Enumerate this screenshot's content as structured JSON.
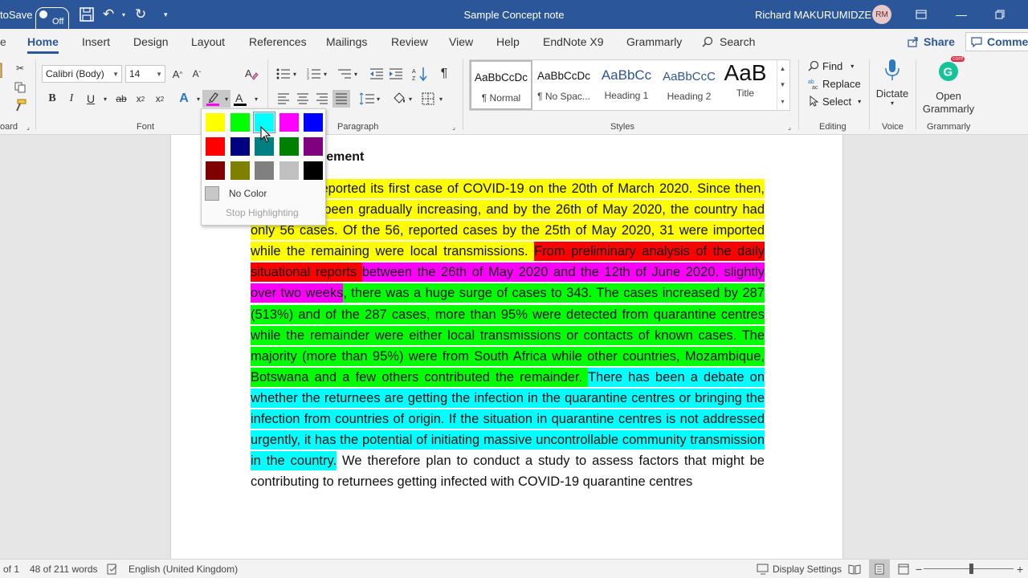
{
  "titlebar": {
    "autosave_label": "toSave",
    "toggle_label": "Off",
    "doc_title": "Sample Concept note",
    "user_name": "Richard MAKURUMIDZE",
    "user_initials": "RM"
  },
  "tabs": [
    "Home",
    "Insert",
    "Design",
    "Layout",
    "References",
    "Mailings",
    "Review",
    "View",
    "Help",
    "EndNote X9",
    "Grammarly"
  ],
  "search_label": "Search",
  "share_label": "Share",
  "comments_label": "Commen",
  "ribbon": {
    "font_name": "Calibri (Body)",
    "font_size": "14",
    "groups": {
      "clipboard": "oard",
      "font": "Font",
      "paragraph": "Paragraph",
      "styles": "Styles",
      "editing": "Editing",
      "voice": "Voice",
      "grammarly": "Grammarly"
    },
    "styles": [
      {
        "preview": "AaBbCcDc",
        "name": "¶ Normal"
      },
      {
        "preview": "AaBbCcDc",
        "name": "¶ No Spac..."
      },
      {
        "preview": "AaBbCc",
        "name": "Heading 1"
      },
      {
        "preview": "AaBbCcC",
        "name": "Heading 2"
      },
      {
        "preview": "AaB",
        "name": "Title"
      }
    ],
    "editing": {
      "find": "Find",
      "replace": "Replace",
      "select": "Select"
    },
    "dictate": "Dictate",
    "grammarly_btn": "Open Grammarly",
    "grammarly_badge": "conf",
    "highlight_color": "#ff00ff",
    "font_color": "#000000"
  },
  "palette": {
    "colors": [
      "#ffff00",
      "#00ff00",
      "#00ffff",
      "#ff00ff",
      "#0000ff",
      "#ff0000",
      "#000080",
      "#008080",
      "#008000",
      "#800080",
      "#800000",
      "#808000",
      "#808080",
      "#c0c0c0",
      "#000000"
    ],
    "no_color": "No Color",
    "stop": "Stop Highlighting"
  },
  "document": {
    "heading": "atement",
    "segments": [
      {
        "text": "Zimbabwe reported its first case of COVID-19 on the 20th of March 2020. Since then, cases have been gradually increasing, and by the 26th of May 2020, the country had only 56 cases. Of the 56, reported cases by the 25th of May 2020, 31 were imported while the remaining were local transmissions. ",
        "bg": "#ffff00",
        "color": "#111111"
      },
      {
        "text": "From preliminary analysis of the daily situational reports ",
        "bg": "#ff0000",
        "color": "#111111"
      },
      {
        "text": "between the 26th of May 2020 and the 12th of June 2020, slightly over two weeks",
        "bg": "#ff00ff",
        "color": "#111111"
      },
      {
        "text": ", there was a huge surge of cases to 343. The cases increased by 287 (513%) and of the 287 cases, more than 95% were detected from quarantine centres while the remainder were either local transmissions or contacts of known cases. The majority (more than 95%) were from South Africa while other countries, Mozambique, Botswana and a few others contributed the remainder. ",
        "bg": "#00ff00",
        "color": "#111111"
      },
      {
        "text": "There has been a debate on whether the returnees are getting the infection in the quarantine centres or bringing the infection from countries of origin. If the situation in quarantine centres is not addressed urgently, it has the potential of initiating massive uncontrollable community transmission in the country.",
        "bg": "#00ffff",
        "color": "#111111"
      },
      {
        "text": " We therefore plan to conduct a study to assess factors that might be contributing to returnees getting infected with COVID-19  quarantine centres",
        "bg": "transparent",
        "color": "#111111"
      }
    ]
  },
  "statusbar": {
    "page": "of 1",
    "words": "48 of 211 words",
    "language": "English (United Kingdom)",
    "display_settings": "Display Settings"
  }
}
